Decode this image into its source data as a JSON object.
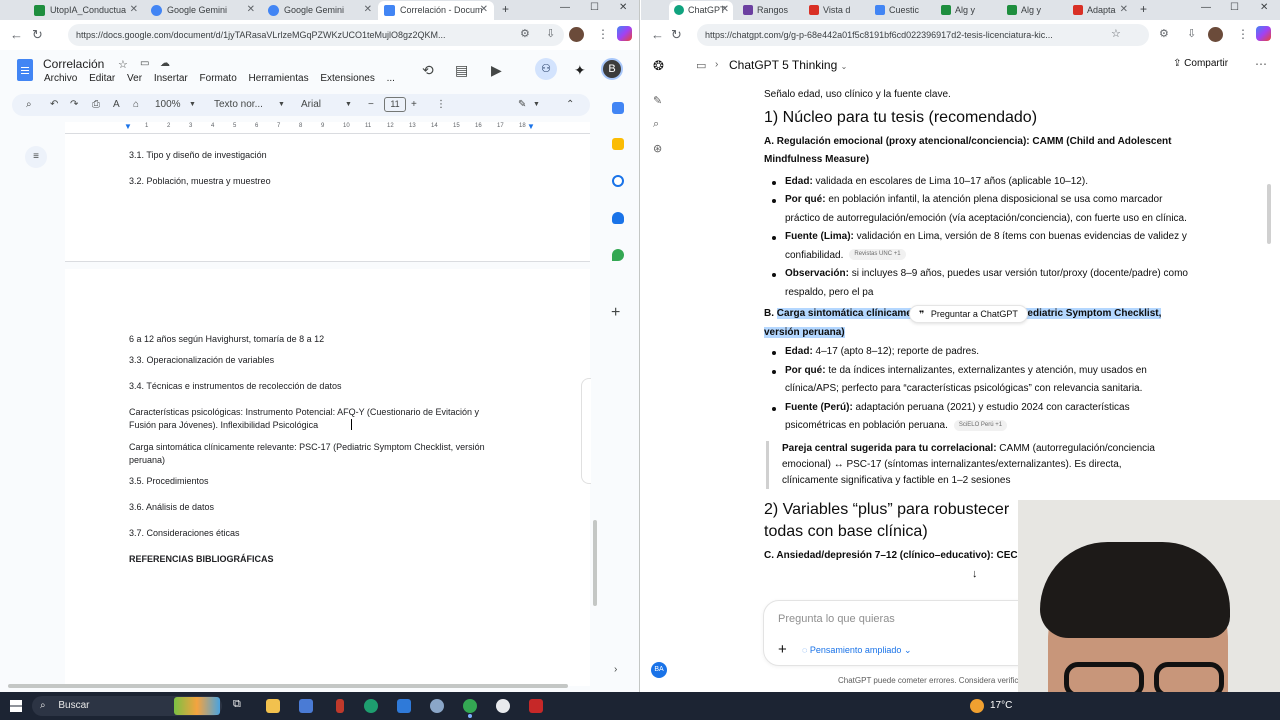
{
  "left_window": {
    "tabs": [
      {
        "title": "UtopIA_Conductua",
        "color": "#1e8e3e"
      },
      {
        "title": "Google Gemini",
        "color": "#4285f4"
      },
      {
        "title": "Google Gemini",
        "color": "#4285f4"
      },
      {
        "title": "Correlación - Docum",
        "color": "#4285f4",
        "active": true
      }
    ],
    "url": "https://docs.google.com/document/d/1jyTARasaVLrlzeMGqPZWKzUCO1teMujlO8gz2QKM...",
    "doc_title": "Correlación",
    "menu": [
      "Archivo",
      "Editar",
      "Ver",
      "Insertar",
      "Formato",
      "Herramientas",
      "Extensiones",
      "..."
    ],
    "profile_initial": "B",
    "toolbar": {
      "zoom": "100%",
      "style": "Texto nor...",
      "font": "Arial",
      "font_size": "11"
    },
    "ruler_ticks": [
      "1",
      "2",
      "3",
      "4",
      "5",
      "6",
      "7",
      "8",
      "9",
      "10",
      "11",
      "12",
      "13",
      "14",
      "15",
      "16",
      "17",
      "18"
    ],
    "page1_lines": [
      "3.1. Tipo y diseño de investigación",
      "3.2. Población, muestra y muestreo"
    ],
    "page2_lines": [
      "6 a 12 años según Havighurst, tomaría de 8 a 12",
      "3.3. Operacionalización de variables",
      "3.4. Técnicas e instrumentos de recolección de datos",
      "Características psicológicas: Instrumento Potencial: AFQ-Y (Cuestionario de Evitación y",
      "Fusión para Jóvenes). Inflexibilidad Psicológica",
      "Carga sintomática clínicamente relevante: PSC-17 (Pediatric Symptom Checklist, versión",
      "peruana)",
      "3.5. Procedimientos",
      "3.6. Análisis de datos",
      "3.7. Consideraciones éticas",
      "REFERENCIAS BIBLIOGRÁFICAS"
    ]
  },
  "right_window": {
    "tabs": [
      {
        "title": "ChatGPT",
        "color": "#10a37f",
        "active": true
      },
      {
        "title": "Rangos",
        "color": "#6b3fa0"
      },
      {
        "title": "Vista d",
        "color": "#d93025"
      },
      {
        "title": "Cuestic",
        "color": "#4285f4"
      },
      {
        "title": "Alg y",
        "color": "#1e8e3e"
      },
      {
        "title": "Alg y",
        "color": "#1e8e3e"
      },
      {
        "title": "Adapta",
        "color": "#d93025"
      }
    ],
    "url": "https://chatgpt.com/g/g-p-68e442a01f5c8191bf6cd022396917d2-tesis-licenciatura-kic...",
    "model": "ChatGPT 5 Thinking",
    "share": "Compartir",
    "chat": {
      "top_line": "Señalo edad, uso clínico y la fuente clave.",
      "h_core": "1) Núcleo para tu tesis (recomendado)",
      "a_title": "A. Regulación emocional (proxy atencional/conciencia): CAMM (Child and Adolescent Mindfulness Measure)",
      "a_items": [
        {
          "k": "Edad:",
          "v": " validada en escolares de Lima 10–17 años (aplicable 10–12).",
          "pill": ""
        },
        {
          "k": "Por qué:",
          "v": " en población infantil, la atención plena disposicional se usa como marcador práctico de autorregulación/emoción (vía aceptación/conciencia), con fuerte uso en clínica.",
          "pill": ""
        },
        {
          "k": "Fuente (Lima):",
          "v": " validación en Lima, versión de 8 ítems con buenas evidencias de validez y confiabilidad.",
          "pill": "Revistas UNC +1"
        },
        {
          "k": "Observación:",
          "v": " si incluyes 8–9 años, puedes usar versión tutor/proxy (docente/padre) como respaldo, pero el pa",
          "pill": ""
        }
      ],
      "ask_popup": "Preguntar a ChatGPT",
      "b_prefix": "B. ",
      "b_title": "Carga sintomática clínicamente relevante: PSC-17 (Pediatric Symptom Checklist, versión peruana)",
      "b_items": [
        {
          "k": "Edad:",
          "v": " 4–17 (apto 8–12); reporte de padres.",
          "pill": ""
        },
        {
          "k": "Por qué:",
          "v": " te da índices internalizantes, externalizantes y atención, muy usados en clínica/APS; perfecto para “características psicológicas” con relevancia sanitaria.",
          "pill": ""
        },
        {
          "k": "Fuente (Perú):",
          "v": " adaptación peruana (2021) y estudio 2024 con características psicométricas en población peruana.",
          "pill": "SciELO Perú +1"
        }
      ],
      "quote_bold": "Pareja central sugerida para tu correlacional:",
      "quote_text": " CAMM (autorregulación/conciencia emocional) ↔ PSC-17 (síntomas internalizantes/externalizantes). Es directa, clínicamente significativa y factible en 1–2 sesiones",
      "h_plus": "2) Variables “plus” para robustecer todas con base clínica)",
      "c_title": "C. Ansiedad/depresión 7–12 (clínico–educativo): CECA"
    },
    "composer_placeholder": "Pregunta lo que quieras",
    "composer_mode": "Pensamiento ampliado",
    "footer": "ChatGPT puede cometer errores. Considera verifica",
    "user_badge": "BA"
  },
  "taskbar": {
    "search": "Buscar",
    "weather": "17°C"
  }
}
